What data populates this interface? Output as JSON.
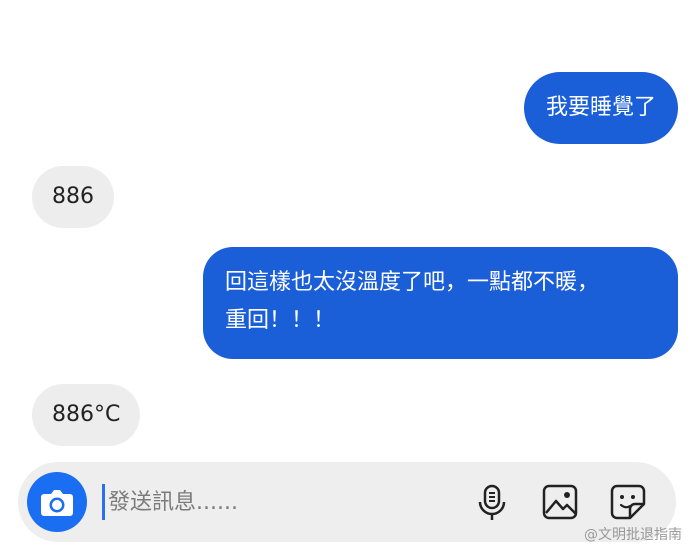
{
  "messages": [
    {
      "side": "sent",
      "text": "我要睡覺了"
    },
    {
      "side": "received",
      "text": "886"
    },
    {
      "side": "sent",
      "lines": [
        "回這樣也太沒溫度了吧，一點都不暖，",
        "重回！！！"
      ]
    },
    {
      "side": "received",
      "text": "886°C"
    }
  ],
  "composer": {
    "placeholder": "發送訊息......",
    "value": ""
  },
  "icons": [
    "camera-icon",
    "microphone-icon",
    "image-icon",
    "sticker-icon"
  ],
  "watermark": "@文明批退指南",
  "colors": {
    "sent_bubble": "#1a5ed8",
    "received_bubble": "#ededed",
    "accent": "#1a6ef2"
  }
}
